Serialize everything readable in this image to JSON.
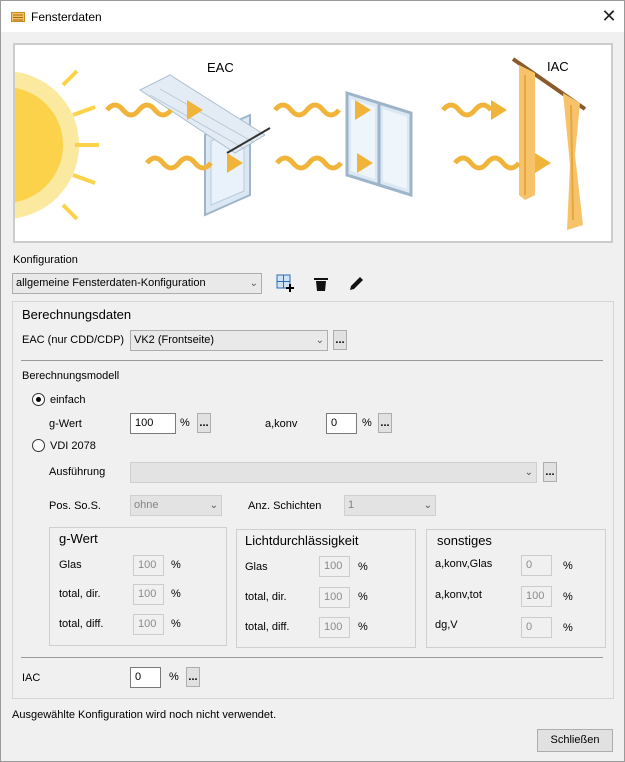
{
  "window": {
    "title": "Fensterdaten",
    "close_label": "✕"
  },
  "banner": {
    "label_eac": "EAC",
    "label_iac": "IAC"
  },
  "konfiguration": {
    "label": "Konfiguration",
    "selected": "allgemeine Fensterdaten-Konfiguration"
  },
  "berechnungsdaten": {
    "title": "Berechnungsdaten",
    "eac_label": "EAC (nur CDD/CDP)",
    "eac_selected": "VK2 (Frontseite)"
  },
  "modell": {
    "title": "Berechnungsmodell",
    "einfach_label": "einfach",
    "vdi_label": "VDI 2078",
    "gwert_label": "g-Wert",
    "gwert_value": "100",
    "gwert_unit": "%",
    "akonv_label": "a,konv",
    "akonv_value": "0",
    "akonv_unit": "%",
    "ausfuehrung_label": "Ausführung",
    "ausfuehrung_value": "",
    "pos_label": "Pos. So.S.",
    "pos_value": "ohne",
    "anz_label": "Anz. Schichten",
    "anz_value": "1"
  },
  "groups": {
    "gwert": {
      "title": "g-Wert",
      "rows": [
        {
          "label": "Glas",
          "value": "100",
          "unit": "%"
        },
        {
          "label": "total, dir.",
          "value": "100",
          "unit": "%"
        },
        {
          "label": "total, diff.",
          "value": "100",
          "unit": "%"
        }
      ]
    },
    "licht": {
      "title": "Lichtdurchlässigkeit",
      "rows": [
        {
          "label": "Glas",
          "value": "100",
          "unit": "%"
        },
        {
          "label": "total, dir.",
          "value": "100",
          "unit": "%"
        },
        {
          "label": "total, diff.",
          "value": "100",
          "unit": "%"
        }
      ]
    },
    "sonst": {
      "title": "sonstiges",
      "rows": [
        {
          "label": "a,konv,Glas",
          "value": "0",
          "unit": "%"
        },
        {
          "label": "a,konv,tot",
          "value": "100",
          "unit": "%"
        },
        {
          "label": "dg,V",
          "value": "0",
          "unit": "%"
        }
      ]
    }
  },
  "iac": {
    "label": "IAC",
    "value": "0",
    "unit": "%"
  },
  "status": "Ausgewählte Konfiguration wird noch nicht verwendet.",
  "close_button": "Schließen",
  "dots": "..."
}
